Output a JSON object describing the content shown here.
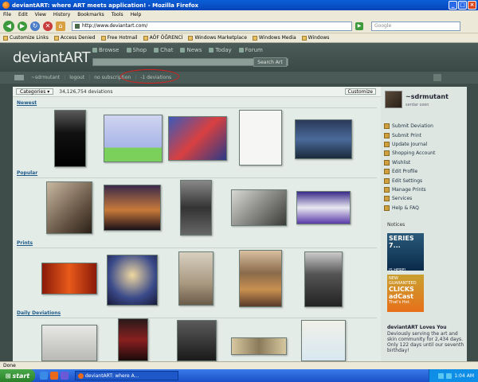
{
  "window": {
    "title": "deviantART: where ART meets application! - Mozilla Firefox"
  },
  "menu": [
    "File",
    "Edit",
    "View",
    "History",
    "Bookmarks",
    "Tools",
    "Help"
  ],
  "address": {
    "url": "http://www.deviantart.com/",
    "search_placeholder": "Google"
  },
  "bookmarks": [
    "Customize Links",
    "Access Denied",
    "Free Hotmail",
    "AÖF ÖĞRENCİ",
    "Windows Marketplace",
    "Windows Media",
    "Windows"
  ],
  "site": {
    "logo": "deviantART",
    "nav": [
      "Browse",
      "Shop",
      "Chat",
      "News",
      "Today",
      "Forum"
    ],
    "search_button": "Search Art",
    "subbar": {
      "user": "~sdrmutant",
      "logout": "logout",
      "subscription": "no subscription",
      "deviations": "-1 deviations"
    }
  },
  "content": {
    "categories_label": "Categories ▾",
    "deviation_count": "34,126,754 deviations",
    "customize_label": "Customize",
    "sections": [
      "Newest",
      "Popular",
      "Prints",
      "Daily Deviations"
    ]
  },
  "sidebar": {
    "username": "~sdrmutant",
    "realname": "serdar ozen",
    "menu": [
      "Submit Deviation",
      "Submit Print",
      "Update Journal",
      "Shopping Account",
      "Wishlist",
      "Edit Profile",
      "Edit Settings",
      "Manage Prints",
      "Services",
      "Help & FAQ"
    ],
    "notices_title": "Notices",
    "ad1": {
      "line1": "SERIES 7...",
      "line2": "IS HERE!"
    },
    "ad2": {
      "line1": "NEW",
      "line2": "GUARANTEED",
      "line3": "CLICKS",
      "line4": "adCast",
      "line5": "That's Hot."
    },
    "loves_title": "deviantART Loves You",
    "loves_text": "Deviously serving the art and skin community for 2,434 days. Only 122 days until our seventh birthday!"
  },
  "statusbar": {
    "text": "Done"
  },
  "taskbar": {
    "start": "start",
    "task": "deviantART: where A...",
    "clock": "1:04 AM"
  }
}
